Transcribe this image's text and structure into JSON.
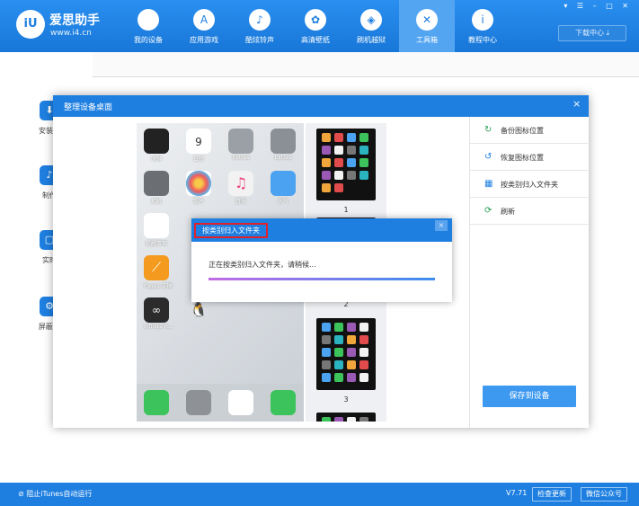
{
  "app": {
    "name": "爱思助手",
    "url": "www.i4.cn",
    "logo_mark": "iU"
  },
  "nav": [
    {
      "label": "我的设备",
      "icon": "apple-icon",
      "glyph": ""
    },
    {
      "label": "应用游戏",
      "icon": "appstore-icon",
      "glyph": "A"
    },
    {
      "label": "酷炫铃声",
      "icon": "bell-icon",
      "glyph": "♪"
    },
    {
      "label": "高清壁纸",
      "icon": "flower-icon",
      "glyph": "✿"
    },
    {
      "label": "刷机越狱",
      "icon": "dropbox-icon",
      "glyph": "◈"
    },
    {
      "label": "工具箱",
      "icon": "tools-icon",
      "glyph": "✕",
      "active": true
    },
    {
      "label": "教程中心",
      "icon": "info-icon",
      "glyph": "i"
    }
  ],
  "window_controls": "▾ ☰ – □ ✕",
  "download_center": "下载中心 ⤓",
  "sidebar": [
    {
      "label": "安装移",
      "icon": "install-icon"
    },
    {
      "label": "制作",
      "icon": "bell-make-icon"
    },
    {
      "label": "实时",
      "icon": "screen-icon"
    },
    {
      "label": "屏蔽iO",
      "icon": "gear-block-icon"
    }
  ],
  "status_bar": {
    "itunes": "阻止iTunes自动运行",
    "version": "V7.71",
    "check_update": "检查更新",
    "wechat": "微信公众号"
  },
  "dialog": {
    "title": "整理设备桌面",
    "close": "×",
    "menu": [
      {
        "label": "备份图标位置",
        "icon": "backup-icon"
      },
      {
        "label": "恢复图标位置",
        "icon": "restore-icon"
      },
      {
        "label": "按类别归入文件夹",
        "icon": "grid-folder-icon"
      },
      {
        "label": "刷新",
        "icon": "refresh-icon"
      }
    ],
    "save": "保存到设备",
    "apps": [
      {
        "name": "时钟",
        "color": "#222"
      },
      {
        "name": "日历",
        "color": "#ffffff",
        "date": "9"
      },
      {
        "name": "Extras",
        "color": "#9aa0a6"
      },
      {
        "name": "Extras",
        "color": "#8a9096"
      },
      {
        "name": "相机",
        "color": "#6b6e72"
      },
      {
        "name": "照片",
        "color": "#ffffff"
      },
      {
        "name": "音乐",
        "color": "#f2f2f2"
      },
      {
        "name": "天气",
        "color": "#4aa2f0"
      },
      {
        "name": "提醒事项",
        "color": "#ffffff"
      },
      {
        "name": "Pages 文稿",
        "color": "#f39a1f"
      },
      {
        "name": "Infinite R...",
        "color": "#2b2b2b"
      }
    ],
    "dock": [
      "电话",
      "设置",
      "Safari",
      "信息"
    ],
    "thumb_pages": [
      "1",
      "2",
      "3"
    ]
  },
  "progress": {
    "title": "按类别归入文件夹",
    "close": "×",
    "message": "正在按类别归入文件夹，请稍候...",
    "percent": 100
  }
}
